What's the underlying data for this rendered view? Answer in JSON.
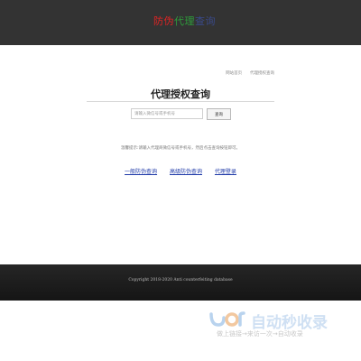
{
  "header": {
    "logo_part1": "防伪",
    "logo_part2": "代理",
    "logo_part3": "查询",
    "color_bg": "#333333"
  },
  "breadcrumb": {
    "home": "网站首页",
    "current": "代理授权查询"
  },
  "main": {
    "title": "代理授权查询",
    "search_placeholder": "请输入微信号或手机号",
    "search_button": "查询",
    "hint": "温馨提示:请输入代理商微信号或手机号，然后点击查询按钮即可。"
  },
  "links": {
    "basic": "一般防伪查询",
    "advanced": "高级防伪查询",
    "agent": "代理登录"
  },
  "footer": {
    "copyright": "Copyright 2018-2020 Anti counterfeiting database"
  },
  "watermark": {
    "title": "自动秒收录",
    "subtitle": "做上链接→来访一次→自动收录"
  }
}
